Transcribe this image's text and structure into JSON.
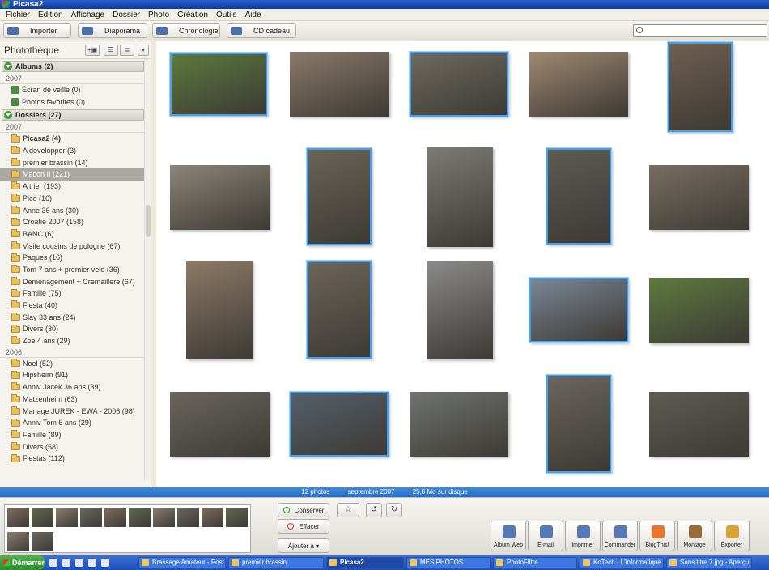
{
  "window": {
    "title": "Picasa2"
  },
  "menu": [
    "Fichier",
    "Edition",
    "Affichage",
    "Dossier",
    "Photo",
    "Création",
    "Outils",
    "Aide"
  ],
  "toolbar": {
    "import": "Importer",
    "slideshow": "Diaporama",
    "timeline": "Chronologie",
    "gift_cd": "CD cadeau",
    "search_placeholder": ""
  },
  "library": {
    "title": "Photothèque",
    "albums_header": "Albums (2)",
    "albums_year": "2007",
    "albums": [
      "Écran de veille (0)",
      "Photos favorites (0)"
    ],
    "folders_header": "Dossiers (27)",
    "year_2007": "2007",
    "folders_2007": [
      "Picasa2 (4)",
      "A developper (3)",
      "premier brassin (14)",
      "Macon II (221)",
      "A trier (193)",
      "Pico (16)",
      "Anne 36 ans (30)",
      "Croatie 2007 (158)",
      "BANC (6)",
      "Visite cousins de pologne (67)",
      "Paques (16)",
      "Tom 7 ans + premier velo (36)",
      "Demenagement + Cremaillere (67)",
      "Famille (75)",
      "Fiesta (40)",
      "Slay 33 ans (24)",
      "Divers (30)",
      "Zoe 4 ans (29)"
    ],
    "year_2006": "2006",
    "folders_2006": [
      "Noel (52)",
      "Hipsheim (91)",
      "Anniv Jacek 36 ans (39)",
      "Matzenheim (63)",
      "Mariage JUREK - EWA - 2006 (98)",
      "Anniv Tom 6 ans (29)",
      "Famille (89)",
      "Divers (58)",
      "Fiestas (112)"
    ]
  },
  "status": {
    "count": "12 photos",
    "date": "septembre 2007",
    "size": "25,8 Mo sur disque"
  },
  "tray": {
    "keep": "Conserver",
    "clear": "Effacer",
    "add_to": "Ajouter à",
    "actions": [
      "Album Web",
      "E-mail",
      "Imprimer",
      "Commander",
      "BlogThis!",
      "Montage",
      "Exporter"
    ]
  },
  "taskbar": {
    "start": "Démarrer",
    "tasks": [
      "Brassage Amateur - Post...",
      "premier brassin",
      "Picasa2",
      "MES PHOTOS",
      "PhotoFiltre",
      "KoTech - L'informatique ...",
      "Sans titre 7.jpg - Aperçu..."
    ]
  },
  "colors": {
    "accent": "#4aa0e8",
    "status_bar": "#2a6ec3",
    "selected_folder": "#aaa8a2"
  }
}
